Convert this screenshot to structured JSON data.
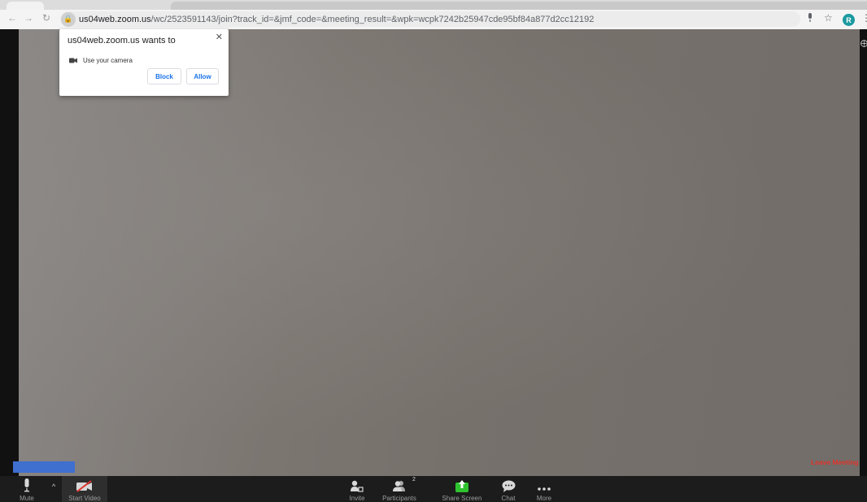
{
  "browser": {
    "url_host": "us04web.zoom.us",
    "url_path": "/wc/2523591143/join?track_id=&jmf_code=&meeting_result=&wpk=wcpk7242b25947cde95bf84a877d2cc12192",
    "profile_initial": "R"
  },
  "permission_popup": {
    "title": "us04web.zoom.us wants to",
    "request": "Use your camera",
    "block_label": "Block",
    "allow_label": "Allow"
  },
  "controls": {
    "mute_label": "Mute",
    "start_video_label": "Start Video",
    "invite_label": "Invite",
    "participants_label": "Participants",
    "participants_count": "2",
    "share_screen_label": "Share Screen",
    "chat_label": "Chat",
    "more_label": "More",
    "leave_label": "Leave Meeting"
  },
  "colors": {
    "leave": "#e0332b",
    "share_green": "#2fc22f",
    "accent_blue": "#1a73e8"
  }
}
